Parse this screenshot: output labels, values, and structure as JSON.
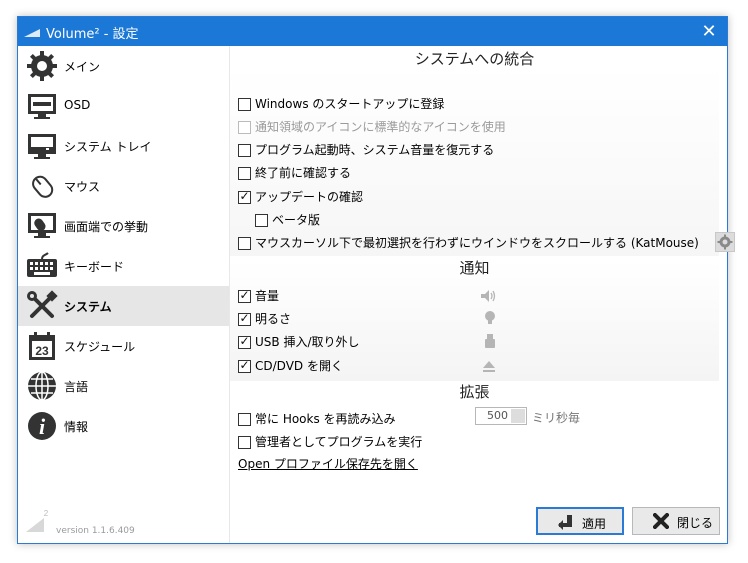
{
  "window": {
    "title": "Volume² - 設定",
    "close_glyph": "✕"
  },
  "sidebar": {
    "items": [
      {
        "label": "メイン",
        "icon": "gear-icon"
      },
      {
        "label": "OSD",
        "icon": "monitor-icon"
      },
      {
        "label": "システム トレイ",
        "icon": "tray-icon"
      },
      {
        "label": "マウス",
        "icon": "mouse-icon"
      },
      {
        "label": "画面端での挙動",
        "icon": "screen-edge-icon"
      },
      {
        "label": "キーボード",
        "icon": "keyboard-icon"
      },
      {
        "label": "システム",
        "icon": "tools-icon"
      },
      {
        "label": "スケジュール",
        "icon": "calendar-icon"
      },
      {
        "label": "言語",
        "icon": "globe-icon"
      },
      {
        "label": "情報",
        "icon": "info-icon"
      }
    ],
    "selected_index": 6,
    "calendar_day": "23",
    "info_glyph": "i",
    "logo_superscript": "2",
    "version": "version 1.1.6.409"
  },
  "integration": {
    "title": "システムへの統合",
    "options": [
      {
        "label": "Windows のスタートアップに登録",
        "checked": false,
        "disabled": false
      },
      {
        "label": "通知領域のアイコンに標準的なアイコンを使用",
        "checked": false,
        "disabled": true
      },
      {
        "label": "プログラム起動時、システム音量を復元する",
        "checked": false,
        "disabled": false
      },
      {
        "label": "終了前に確認する",
        "checked": false,
        "disabled": false
      },
      {
        "label": "アップデートの確認",
        "checked": true,
        "disabled": false
      },
      {
        "label": "ベータ版",
        "checked": false,
        "disabled": false
      },
      {
        "label": "マウスカーソル下で最初選択を行わずにウインドウをスクロールする (KatMouse)",
        "checked": false,
        "disabled": false
      }
    ]
  },
  "notify": {
    "title": "通知",
    "options": [
      {
        "label": "音量",
        "checked": true,
        "icon": "speaker-icon"
      },
      {
        "label": "明るさ",
        "checked": true,
        "icon": "bulb-icon"
      },
      {
        "label": "USB 挿入/取り外し",
        "checked": true,
        "icon": "usb-icon"
      },
      {
        "label": "CD/DVD を開く",
        "checked": true,
        "icon": "eject-icon"
      }
    ]
  },
  "extend": {
    "title": "拡張",
    "reload_hooks_label": "常に Hooks を再読み込み",
    "reload_hooks_checked": false,
    "interval_value": "500",
    "interval_unit": "ミリ秒毎",
    "run_admin_label": "管理者としてプログラムを実行",
    "run_admin_checked": false,
    "open_profile_link": "Open プロファイル保存先を開く"
  },
  "footer": {
    "apply_label": "適用",
    "close_label": "閉じる"
  },
  "tick_glyph": "✓",
  "colors": {
    "titlebar": "#1c78d6",
    "accent": "#2b7bd6",
    "selected_bg": "#e6e6e6"
  }
}
